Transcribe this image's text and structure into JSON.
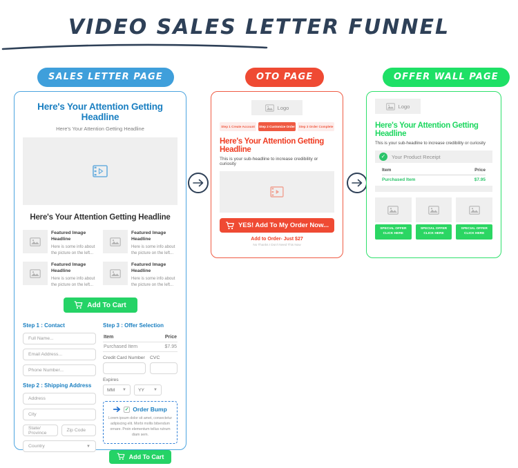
{
  "header": {
    "title": "VIDEO SALES LETTER FUNNEL",
    "badges": [
      {
        "label": "SALES LETTER PAGE",
        "color": "#3f9fdb"
      },
      {
        "label": "OTO PAGE",
        "color": "#ef4a33"
      },
      {
        "label": "OFFER WALL PAGE",
        "color": "#1ee066"
      }
    ]
  },
  "sales_page": {
    "headline": "Here's Your Attention Getting Headline",
    "subheadline": "Here's Your Attention Getting Headline",
    "video_icon": "video-film-icon",
    "section_headline": "Here's Your Attention Getting Headline",
    "features": [
      {
        "title": "Featured Image Headline",
        "desc": "Here is some info about the picture on the left...",
        "icon": "image-placeholder-icon"
      },
      {
        "title": "Featured Image Headline",
        "desc": "Here is some info about the picture on the left...",
        "icon": "image-placeholder-icon"
      },
      {
        "title": "Featured Image Headline",
        "desc": "Here is some info about the picture on the left...",
        "icon": "image-placeholder-icon"
      },
      {
        "title": "Featured Image Headline",
        "desc": "Here is some info about the picture on the left...",
        "icon": "image-placeholder-icon"
      }
    ],
    "cta_primary": "Add To Cart",
    "cta_secondary": "Add To Cart",
    "step1_title": "Step 1 : Contact",
    "step2_title": "Step 2 : Shipping Address",
    "step3_title": "Step 3 : Offer Selection",
    "contact_fields": [
      {
        "placeholder": "Full Name..."
      },
      {
        "placeholder": "Email Address..."
      },
      {
        "placeholder": "Phone Number..."
      }
    ],
    "shipping_fields": {
      "address": "Address",
      "city": "City",
      "state": "State/ Province",
      "zip": "Zip Code",
      "country": "Country"
    },
    "offer_table": {
      "col_item": "Item",
      "col_price": "Price",
      "row_item": "Purchased Item",
      "row_price": "$7.95"
    },
    "payment": {
      "cc_label": "Credit Card Number",
      "cvc_label": "CVC",
      "expires_label": "Expires",
      "month": "MM",
      "year": "YY"
    },
    "order_bump": {
      "title": "Order Bump",
      "body": "Lorem ipsum dolor sit amet, consectetur adipiscing elit. Morbi mollis bibendum ornare. Proin elementum tellus rutrum diam sem.",
      "arrow_icon": "right-arrow-icon",
      "check_icon": "checkbox-checked-icon"
    }
  },
  "oto_page": {
    "logo_label": "Logo",
    "logo_icon": "image-placeholder-icon",
    "steps": [
      {
        "label": "Step 1 Create Account",
        "active": false
      },
      {
        "label": "Step 2 Customize Order",
        "active": true
      },
      {
        "label": "Step 3 Order Complete",
        "active": false
      }
    ],
    "headline": "Here's Your Attention Getting Headline",
    "subheadline": "This is your sub-headline to increase credibility or curiosity",
    "video_icon": "video-film-icon",
    "cta": "YES! Add To My Order Now...",
    "cart_icon": "shopping-cart-icon",
    "footer_primary": "Add to Order- Just $27",
    "footer_secondary": "No Thanks I Don't Need This Now"
  },
  "offer_wall_page": {
    "logo_label": "Logo",
    "logo_icon": "image-placeholder-icon",
    "headline": "Here's Your Attention Getting Headline",
    "subheadline": "This is your sub-headline to increase credibility or curiosity",
    "receipt_label": "Your Product Receipt",
    "receipt_icon": "check-circle-icon",
    "table": {
      "col_item": "Item",
      "col_price": "Price",
      "row_item": "Purchased Item",
      "row_price": "$7.95"
    },
    "offers": [
      {
        "line1": "SPECIAL OFFER",
        "line2": "CLICK HERE",
        "icon": "image-placeholder-icon"
      },
      {
        "line1": "SPECIAL OFFER",
        "line2": "CLICK HERE",
        "icon": "image-placeholder-icon"
      },
      {
        "line1": "SPECIAL OFFER",
        "line2": "CLICK HERE",
        "icon": "image-placeholder-icon"
      }
    ]
  },
  "connectors": [
    {
      "icon": "right-arrow-circle-icon"
    },
    {
      "icon": "right-arrow-circle-icon"
    }
  ]
}
